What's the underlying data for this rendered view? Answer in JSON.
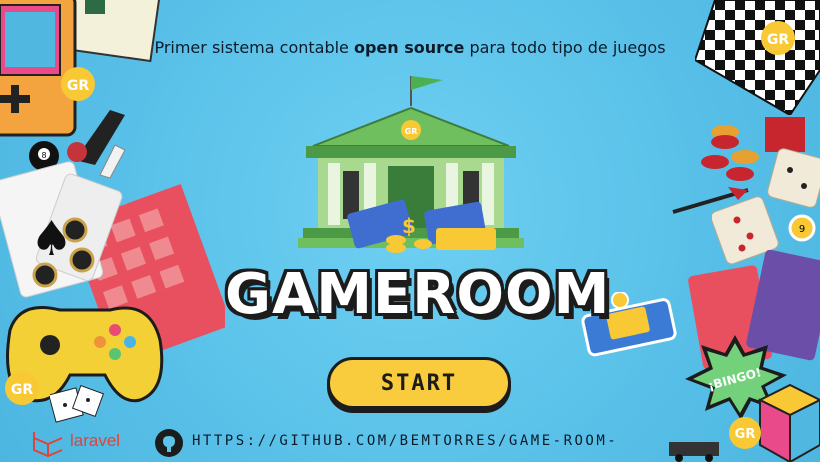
{
  "tagline": {
    "prefix": "Primer sistema contable ",
    "bold": "open source",
    "suffix": " para todo tipo de juegos"
  },
  "title": "GAMEROOM",
  "start_button": "START",
  "footer": {
    "url": "HTTPS://GITHUB.COM/BEMTORRES/GAME-ROOM-",
    "laravel": "laravel"
  },
  "logo_badge": "GR",
  "bingo_badge": "¡BINGO!",
  "colors": {
    "background": "#5cc4ea",
    "accent_yellow": "#f8cc3c",
    "bank_green": "#6fbf5e",
    "outline": "#1c1c1c",
    "laravel_red": "#e0433a"
  }
}
